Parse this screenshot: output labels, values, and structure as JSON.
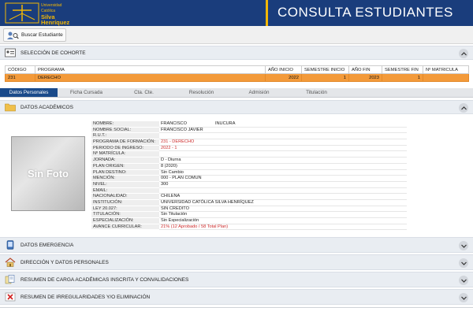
{
  "header": {
    "logo_line1": "Universidad",
    "logo_line2": "Católica",
    "logo_line3": "Silva",
    "logo_line4": "Henríquez",
    "title": "CONSULTA ESTUDIANTES",
    "colors": {
      "bar": "#1a3d7c",
      "accent": "#f2b705"
    }
  },
  "toolbar": {
    "buscar_label": "Buscar Estudiante",
    "buscar_icon": "search-user-icon"
  },
  "cohorte": {
    "section_title": "SELECCIÓN DE COHORTE",
    "columns": [
      "CÓDIGO",
      "PROGRAMA",
      "AÑO INICIO",
      "SEMESTRE INICIO",
      "AÑO FIN",
      "SEMESTRE FIN",
      "Nº MATRICULA"
    ],
    "row": {
      "codigo": "231",
      "programa": "DERECHO",
      "anio_inicio": "2022",
      "semestre_inicio": "1",
      "anio_fin": "2023",
      "semestre_fin": "1",
      "matricula": ""
    },
    "highlight_color": "#f39a3a"
  },
  "tabs": [
    {
      "label": "Datos Personales",
      "active": true
    },
    {
      "label": "Ficha Cursada"
    },
    {
      "label": "Cta. Cte."
    },
    {
      "label": "Resolución"
    },
    {
      "label": "Admisión"
    },
    {
      "label": "Titulación"
    }
  ],
  "datos_academicos": {
    "section_title": "DATOS ACADÉMICOS",
    "foto_text": "Sin Foto",
    "fields": [
      {
        "label": "NOMBRE:",
        "value": "FRANCISCO",
        "value2": "INUCURA"
      },
      {
        "label": "NOMBRE SOCIAL:",
        "value": "FRANCISCO JAVIER"
      },
      {
        "label": "R.U.T.:",
        "value": ""
      },
      {
        "label": "PROGRAMA DE FORMACIÓN:",
        "value": "231 - DERECHO",
        "red": true
      },
      {
        "label": "PERIODO DE INGRESO:",
        "value": "2022 - 1",
        "red": true
      },
      {
        "label": "Nº MATRÍCULA:",
        "value": ""
      },
      {
        "label": "JORNADA:",
        "value": "D - Diurna"
      },
      {
        "label": "PLAN ORIGEN:",
        "value": "8 (2020)"
      },
      {
        "label": "PLAN DESTINO:",
        "value": "Sin Cambio"
      },
      {
        "label": "MENCIÓN:",
        "value": "000 - PLAN COMUN"
      },
      {
        "label": "NIVEL:",
        "value": "300"
      },
      {
        "label": "EMAIL:",
        "value": ""
      },
      {
        "label": "NACIONALIDAD:",
        "value": "CHILENA"
      },
      {
        "label": "INSTITUCIÓN:",
        "value": "UNIVERSIDAD CATÓLICA SILVA HENRÍQUEZ"
      },
      {
        "label": "LEY 20.027:",
        "value": "SIN CREDITO"
      },
      {
        "label": "TITULACIÓN:",
        "value": "Sin Titulación"
      },
      {
        "label": "ESPECIALIZACIÓN:",
        "value": "Sin Especialización"
      },
      {
        "label": "AVANCE CURRICULAR:",
        "value": "21% (12 Aprobado / 58 Total Plan)",
        "red": true
      }
    ]
  },
  "sections": [
    {
      "title": "DATOS EMERGENCIA",
      "icon": "phone-icon"
    },
    {
      "title": "DIRECCIÓN Y DATOS PERSONALES",
      "icon": "home-icon"
    },
    {
      "title": "RESUMEN DE CARGA ACADÉMICAS INSCRITA Y CONVALIDACIONES",
      "icon": "documents-icon"
    },
    {
      "title": "RESUMEN DE IRREGULARIDADES Y/O ELIMINACIÓN",
      "icon": "error-icon"
    }
  ]
}
